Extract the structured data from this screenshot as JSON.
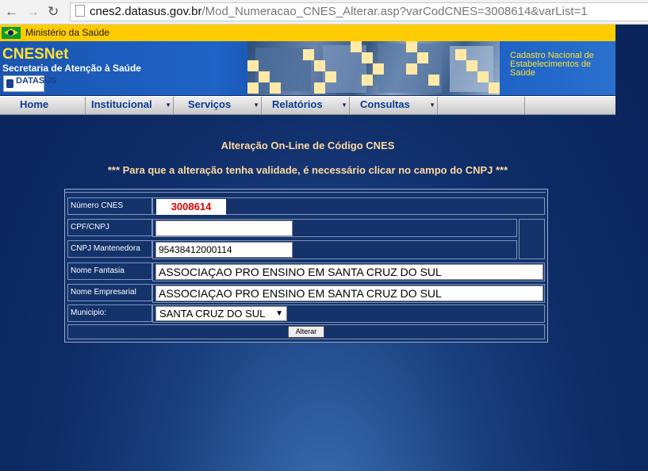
{
  "browser": {
    "url_host": "cnes2.datasus.gov.br",
    "url_path": "/Mod_Numeracao_CNES_Alterar.asp?varCodCNES=3008614&varList=1",
    "back_icon": "back-arrow-icon",
    "forward_icon": "forward-arrow-icon",
    "reload_icon": "reload-icon"
  },
  "header": {
    "ministry": "Ministério da Saúde",
    "brand": "CNESNet",
    "brand_sub": "Secretaria de Atenção à Saúde",
    "datasus": "DATASUS",
    "cadastro_line1": "Cadastro Nacional de",
    "cadastro_line2": "Estabelecimentos de",
    "cadastro_line3": "Saúde"
  },
  "menu": {
    "items": [
      {
        "label": "Home"
      },
      {
        "label": "Institucional"
      },
      {
        "label": "Serviços"
      },
      {
        "label": "Relatórios"
      },
      {
        "label": "Consultas"
      }
    ]
  },
  "page": {
    "title": "Alteração On-Line de Código CNES",
    "warning": "*** Para que a alteração tenha validade, é necessário clicar no campo do CNPJ ***"
  },
  "form": {
    "numero_cnes_label": "Número CNES",
    "numero_cnes_value": "3008614",
    "cpf_cnpj_label": "CPF/CNPJ",
    "cpf_cnpj_value": "",
    "cnpj_mantenedora_label": "CNPJ Mantenedora",
    "cnpj_mantenedora_value": "95438412000114",
    "nome_fantasia_label": "Nome Fantasia",
    "nome_fantasia_value": "ASSOCIAÇAO PRO ENSINO EM SANTA CRUZ DO SUL",
    "nome_empresarial_label": "Nome Empresarial",
    "nome_empresarial_value": "ASSOCIAÇAO PRO ENSINO EM SANTA CRUZ DO SUL",
    "municipio_label": "Municipio:",
    "municipio_value": "SANTA CRUZ DO SUL",
    "submit_label": "Alterar"
  },
  "colors": {
    "accent_yellow": "#ffcc00",
    "title_text": "#ffd8a0",
    "cnes_red": "#e00000",
    "menu_text": "#0b3c8f"
  }
}
